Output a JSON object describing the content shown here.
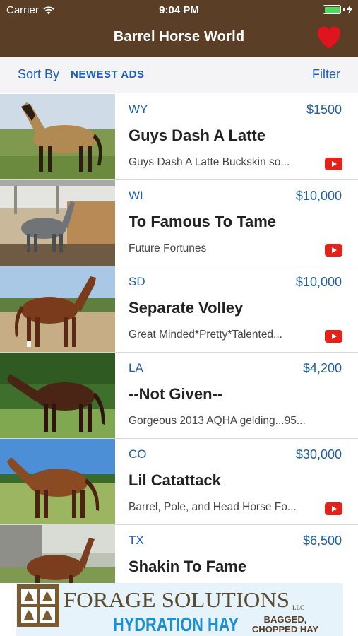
{
  "status": {
    "carrier": "Carrier",
    "time": "9:04 PM"
  },
  "nav": {
    "title": "Barrel Horse World"
  },
  "sortbar": {
    "sort_label": "Sort By",
    "sort_value": "NEWEST ADS",
    "filter_label": "Filter"
  },
  "listings": [
    {
      "state": "WY",
      "price": "$1500",
      "title": "Guys Dash A Latte",
      "description": "Guys Dash A Latte Buckskin so...",
      "has_video": true
    },
    {
      "state": "WI",
      "price": "$10,000",
      "title": "To Famous To Tame",
      "description": "Future Fortunes",
      "has_video": true
    },
    {
      "state": "SD",
      "price": "$10,000",
      "title": "Separate Volley",
      "description": "Great Minded*Pretty*Talented...",
      "has_video": true
    },
    {
      "state": "LA",
      "price": "$4,200",
      "title": "--Not Given--",
      "description": "Gorgeous 2013 AQHA gelding...95...",
      "has_video": false
    },
    {
      "state": "CO",
      "price": "$30,000",
      "title": "Lil Catattack",
      "description": "Barrel, Pole, and Head Horse Fo...",
      "has_video": true
    },
    {
      "state": "TX",
      "price": "$6,500",
      "title": "Shakin To Fame",
      "description": "",
      "has_video": false
    }
  ],
  "banner": {
    "brand": "FORAGE SOLUTIONS",
    "brand_suffix": "LLC",
    "product": "HYDRATION HAY",
    "tagline_1": "BAGGED,",
    "tagline_2": "CHOPPED HAY"
  },
  "colors": {
    "nav_bg": "#5a3e25",
    "accent_blue": "#1b5fbf",
    "price_blue": "#1d5fa6",
    "heart_red": "#e0141e",
    "youtube_red": "#e62117"
  }
}
